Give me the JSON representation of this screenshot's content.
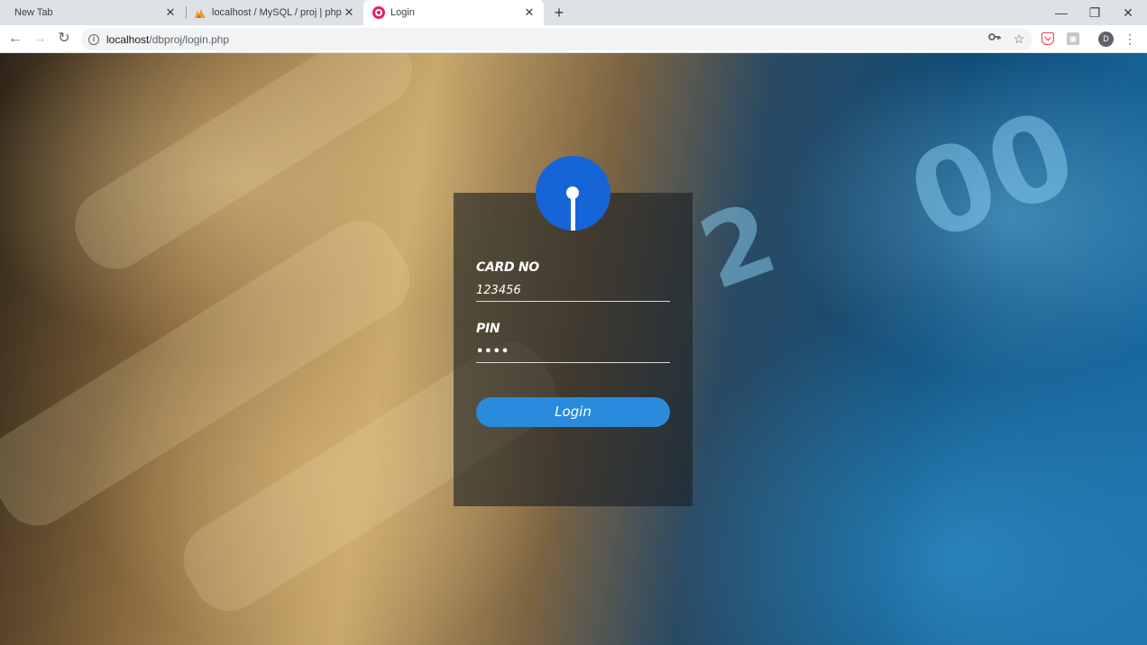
{
  "browser": {
    "tabs": [
      {
        "title": "New Tab",
        "active": false
      },
      {
        "title": "localhost / MySQL / proj | phpMyAdmin",
        "active": false
      },
      {
        "title": "Login",
        "active": true
      }
    ],
    "url_host": "localhost",
    "url_path": "/dbproj/login.php",
    "profile_initial": "D",
    "icons": {
      "back": "back-arrow-icon",
      "forward": "forward-arrow-icon",
      "reload": "reload-icon",
      "site_info": "info-icon",
      "key": "key-icon",
      "bookmark": "star-icon",
      "menu": "kebab-menu-icon"
    }
  },
  "login": {
    "card_label": "CARD NO",
    "card_value": "123456",
    "pin_label": "PIN",
    "pin_value": "••••",
    "button_label": "Login",
    "colors": {
      "logo": "#1565d8",
      "button": "#2a8bdc",
      "panel": "rgba(28,32,36,0.62)"
    }
  }
}
